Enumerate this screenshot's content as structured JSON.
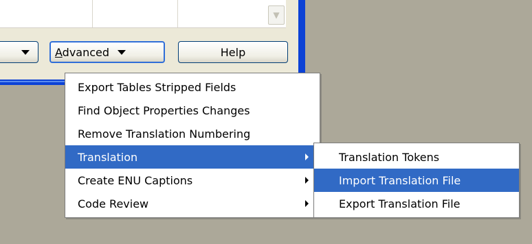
{
  "colors": {
    "desktop": "#aca899",
    "window_face": "#ece9d8",
    "window_frame_blue": "#0c42d6",
    "selection": "#316ac5"
  },
  "toolbar": {
    "advanced_label": "Advanced",
    "advanced_accelerator": "A",
    "advanced_rest": "dvanced",
    "help_label": "Help"
  },
  "icons": {
    "dropdown": "chevron-down-icon",
    "submenu": "chevron-right-icon",
    "scroll_down": "scroll-down-icon"
  },
  "advanced_menu": {
    "items": [
      {
        "label": "Export Tables Stripped Fields",
        "has_submenu": false,
        "selected": false
      },
      {
        "label": "Find Object Properties Changes",
        "has_submenu": false,
        "selected": false
      },
      {
        "label": "Remove Translation Numbering",
        "has_submenu": false,
        "selected": false
      },
      {
        "label": "Translation",
        "has_submenu": true,
        "selected": true
      },
      {
        "label": "Create ENU Captions",
        "has_submenu": true,
        "selected": false
      },
      {
        "label": "Code Review",
        "has_submenu": true,
        "selected": false
      }
    ]
  },
  "translation_submenu": {
    "items": [
      {
        "label": "Translation Tokens",
        "selected": false
      },
      {
        "label": "Import Translation File",
        "selected": true
      },
      {
        "label": "Export Translation File",
        "selected": false
      }
    ]
  }
}
